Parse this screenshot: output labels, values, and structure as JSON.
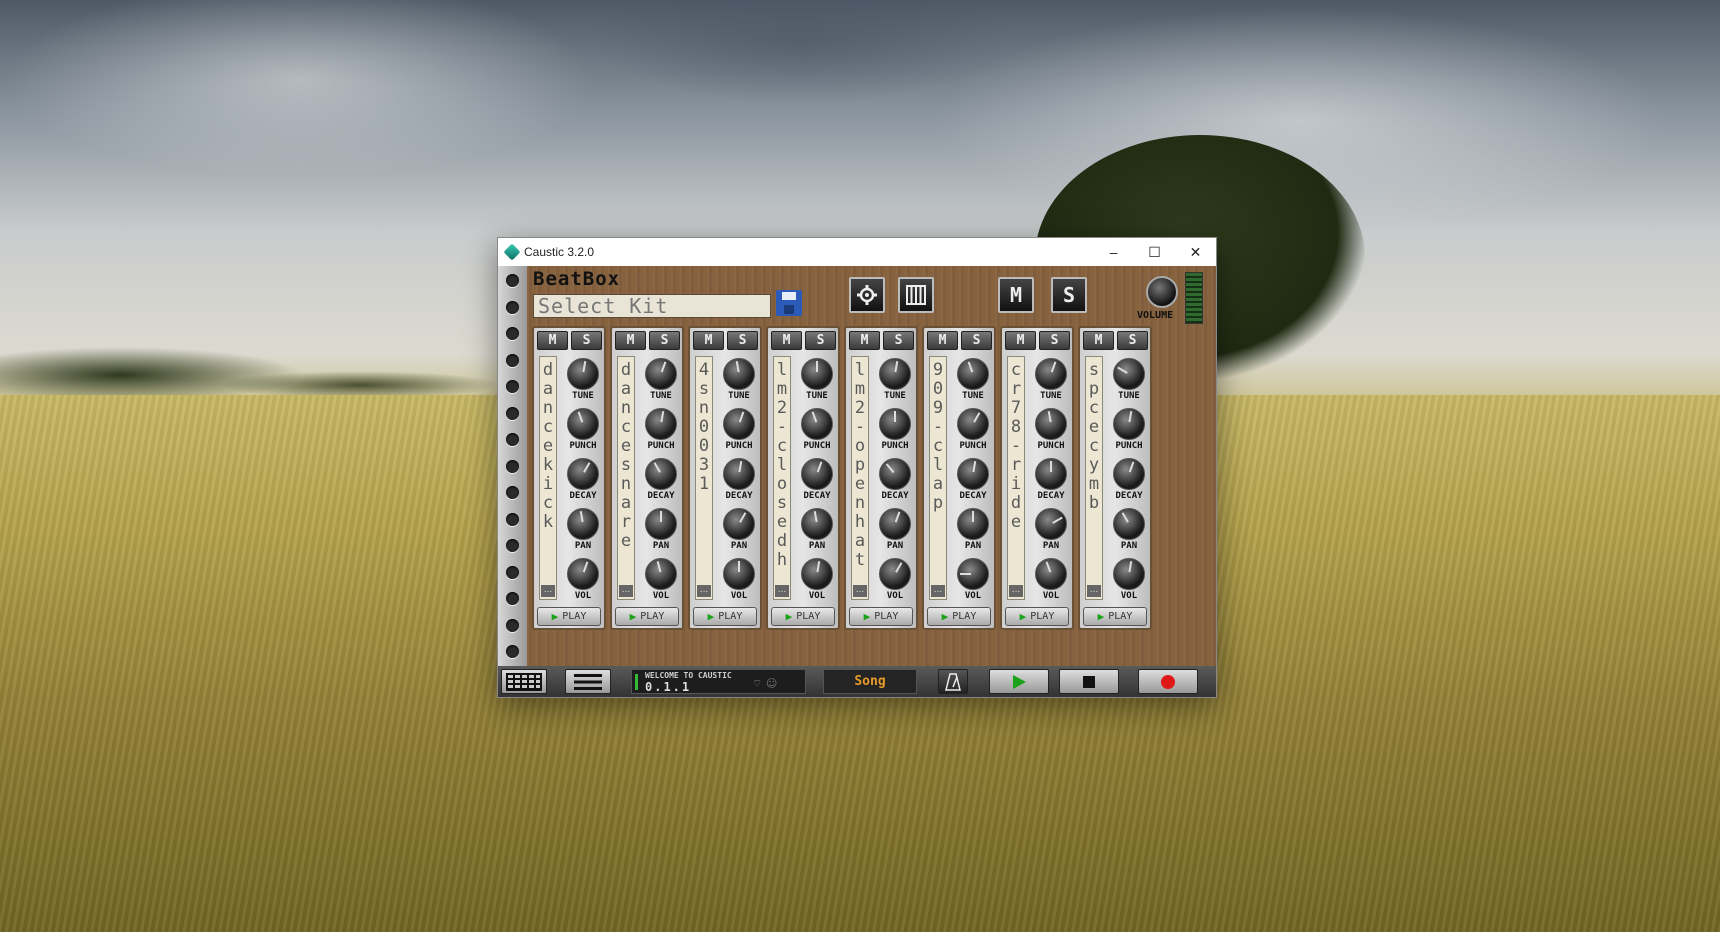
{
  "window": {
    "title": "Caustic 3.2.0",
    "controls": [
      "–",
      "☐",
      "✕"
    ]
  },
  "header": {
    "title": "BeatBox",
    "kit_field": "Select Kit",
    "buttons": {
      "settings_icon": "gear-icon",
      "keyboard_icon": "piano-icon",
      "mute": "M",
      "solo": "S"
    },
    "volume_label": "VOLUME"
  },
  "channel_labels": {
    "mute": "M",
    "solo": "S",
    "more": "...",
    "tune": "TUNE",
    "punch": "PUNCH",
    "decay": "DECAY",
    "pan": "PAN",
    "vol": "VOL",
    "play": "PLAY"
  },
  "channels": [
    {
      "name": "dancekick"
    },
    {
      "name": "dancesnare"
    },
    {
      "name": "4sn0031"
    },
    {
      "name": "lm2-closedh"
    },
    {
      "name": "lm2-openhat"
    },
    {
      "name": "909-clap"
    },
    {
      "name": "cr78-ride"
    },
    {
      "name": "spce cymb"
    }
  ],
  "bottombar": {
    "status_line1": "WELCOME TO CAUSTIC",
    "status_line2": "0.1.1",
    "mode": "Song",
    "icons": [
      "grid-icon",
      "menu-icon",
      "metronome-icon",
      "play-icon",
      "stop-icon",
      "record-icon"
    ]
  },
  "colors": {
    "panel": "#86623f",
    "play_green": "#1aa21a",
    "record_red": "#e01818",
    "song_orange": "#e79a2a"
  }
}
